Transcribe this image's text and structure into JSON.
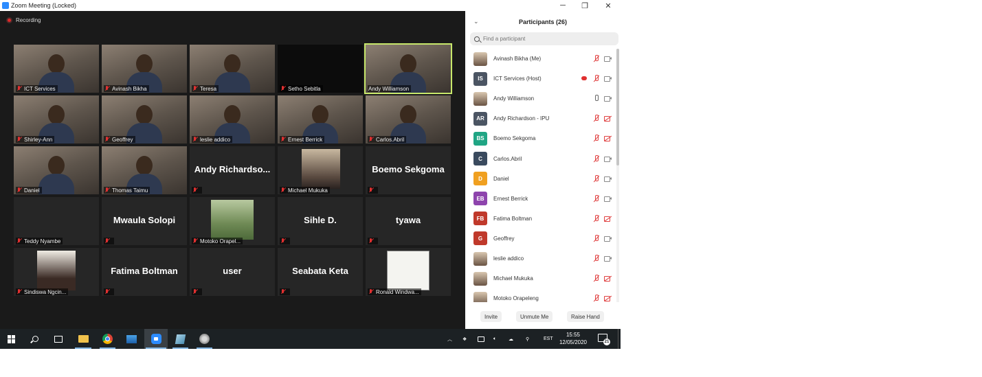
{
  "window": {
    "title": "Zoom Meeting (Locked)",
    "minimize_label": "─",
    "restore_label": "❐",
    "close_label": "✕"
  },
  "meeting": {
    "recording_label": "Recording",
    "tiles": [
      {
        "name": "ICT Services",
        "kind": "video",
        "muted": true
      },
      {
        "name": "Avinash Bikha",
        "kind": "video",
        "muted": true
      },
      {
        "name": "Teresa",
        "kind": "video",
        "muted": true
      },
      {
        "name": "Setho Sebitla",
        "kind": "dark",
        "muted": true
      },
      {
        "name": "Andy Williamson",
        "kind": "video",
        "muted": false,
        "active": true
      },
      {
        "name": "Shirley-Ann",
        "kind": "video",
        "muted": true
      },
      {
        "name": "Geoffrey",
        "kind": "video",
        "muted": true
      },
      {
        "name": "leslie addico",
        "kind": "video",
        "muted": true
      },
      {
        "name": "Ernest Berrick",
        "kind": "video",
        "muted": true
      },
      {
        "name": "Carlos.Abril",
        "kind": "video",
        "muted": true
      },
      {
        "name": "Daniel",
        "kind": "video",
        "muted": true
      },
      {
        "name": "Thomas Taimu",
        "kind": "video",
        "muted": true
      },
      {
        "name": "",
        "kind": "text",
        "big_name": "Andy  Richardso...",
        "muted": true
      },
      {
        "name": "Michael Mukuka",
        "kind": "thumb-room",
        "muted": true
      },
      {
        "name": "",
        "kind": "text",
        "big_name": "Boemo Sekgoma",
        "muted": true
      },
      {
        "name": "Teddy Nyambe",
        "kind": "empty",
        "muted": true
      },
      {
        "name": "",
        "kind": "text",
        "big_name": "Mwaula Solopi",
        "muted": true
      },
      {
        "name": "Motoko Orapel...",
        "kind": "thumb",
        "muted": true
      },
      {
        "name": "",
        "kind": "text",
        "big_name": "Sihle D.",
        "muted": true
      },
      {
        "name": "",
        "kind": "text",
        "big_name": "tyawa",
        "muted": true
      },
      {
        "name": "Sindiswa Ngcin...",
        "kind": "thumb-face",
        "muted": true
      },
      {
        "name": "",
        "kind": "text",
        "big_name": "Fatima Boltman",
        "muted": true
      },
      {
        "name": "",
        "kind": "text",
        "big_name": "user",
        "muted": true
      },
      {
        "name": "",
        "kind": "text",
        "big_name": "Seabata Keta",
        "muted": true
      },
      {
        "name": "Ronald Windwa...",
        "kind": "thumb-paper",
        "muted": true
      }
    ]
  },
  "participants": {
    "title": "Participants (26)",
    "search_placeholder": "Find a participant",
    "list": [
      {
        "name": "Avinash Bikha (Me)",
        "initials": "",
        "color": "",
        "photo": true,
        "mic": "muted",
        "cam": "on",
        "rec": false
      },
      {
        "name": "ICT Services (Host)",
        "initials": "IS",
        "color": "#4b5563",
        "photo": false,
        "mic": "muted",
        "cam": "on",
        "rec": true
      },
      {
        "name": "Andy Williamson",
        "initials": "",
        "color": "",
        "photo": true,
        "mic": "on",
        "cam": "on",
        "rec": false
      },
      {
        "name": "Andy Richardson - IPU",
        "initials": "AR",
        "color": "#4b5563",
        "photo": false,
        "mic": "muted",
        "cam": "off",
        "rec": false
      },
      {
        "name": "Boemo Sekgoma",
        "initials": "BS",
        "color": "#20a584",
        "photo": false,
        "mic": "muted",
        "cam": "off",
        "rec": false
      },
      {
        "name": "Carlos.Abril",
        "initials": "C",
        "color": "#3a4a5e",
        "photo": false,
        "mic": "muted",
        "cam": "on",
        "rec": false
      },
      {
        "name": "Daniel",
        "initials": "D",
        "color": "#f0a020",
        "photo": false,
        "mic": "muted",
        "cam": "on",
        "rec": false
      },
      {
        "name": "Ernest Berrick",
        "initials": "EB",
        "color": "#8e44ad",
        "photo": false,
        "mic": "muted",
        "cam": "on",
        "rec": false
      },
      {
        "name": "Fatima Boltman",
        "initials": "FB",
        "color": "#c0392b",
        "photo": false,
        "mic": "muted",
        "cam": "off",
        "rec": false
      },
      {
        "name": "Geoffrey",
        "initials": "G",
        "color": "#c0392b",
        "photo": false,
        "mic": "muted",
        "cam": "on",
        "rec": false
      },
      {
        "name": "leslie addico",
        "initials": "",
        "color": "",
        "photo": true,
        "mic": "muted",
        "cam": "on",
        "rec": false
      },
      {
        "name": "Michael Mukuka",
        "initials": "",
        "color": "",
        "photo": true,
        "mic": "muted",
        "cam": "off",
        "rec": false
      },
      {
        "name": "Motoko Orapeleng",
        "initials": "",
        "color": "",
        "photo": true,
        "mic": "muted",
        "cam": "off",
        "rec": false
      }
    ],
    "actions": {
      "invite": "Invite",
      "unmute": "Unmute Me",
      "raise_hand": "Raise Hand"
    }
  },
  "taskbar": {
    "tray_language": "EST",
    "clock_time": "15:55",
    "clock_date": "12/05/2020",
    "notification_count": "21"
  }
}
